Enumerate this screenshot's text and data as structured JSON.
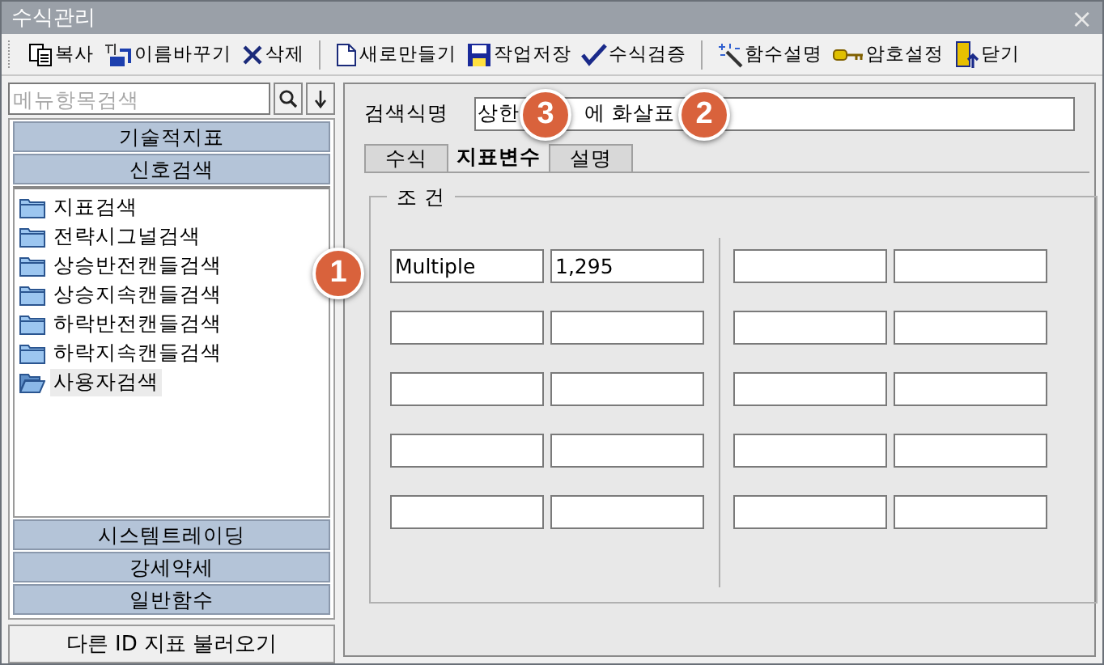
{
  "window": {
    "title": "수식관리",
    "close": "×"
  },
  "toolbar": [
    {
      "kind": "copy",
      "label": "복사"
    },
    {
      "kind": "rename",
      "label": "이름바꾸기"
    },
    {
      "kind": "delete",
      "label": "삭제"
    },
    {
      "kind": "new",
      "label": "새로만들기",
      "group_start": true
    },
    {
      "kind": "save",
      "label": "작업저장"
    },
    {
      "kind": "verify",
      "label": "수식검증"
    },
    {
      "kind": "wand",
      "label": "함수설명",
      "group_start": true
    },
    {
      "kind": "key",
      "label": "암호설정"
    },
    {
      "kind": "exit",
      "label": "닫기"
    }
  ],
  "sidebar": {
    "search": {
      "placeholder": "메뉴항목검색"
    },
    "top_sections": [
      "기술적지표",
      "신호검색"
    ],
    "items": [
      {
        "label": "지표검색",
        "selected": false
      },
      {
        "label": "전략시그널검색",
        "selected": false
      },
      {
        "label": "상승반전캔들검색",
        "selected": false
      },
      {
        "label": "상승지속캔들검색",
        "selected": false
      },
      {
        "label": "하락반전캔들검색",
        "selected": false
      },
      {
        "label": "하락지속캔들검색",
        "selected": false
      },
      {
        "label": "사용자검색",
        "selected": true
      }
    ],
    "bottom_sections": [
      "시스템트레이딩",
      "강세약세",
      "일반함수"
    ],
    "load_button": "다른 ID 지표 불러오기"
  },
  "editor": {
    "name_label": "검색식명",
    "name_value_parts": [
      "상한",
      "에 화살표"
    ],
    "tabs": [
      {
        "label": "수식",
        "selected": false
      },
      {
        "label": "지표변수",
        "selected": true
      },
      {
        "label": "설명",
        "selected": false
      }
    ],
    "group_title": "조 건",
    "left_rows": [
      [
        "Multiple",
        "1,295"
      ],
      [
        "",
        ""
      ],
      [
        "",
        ""
      ],
      [
        "",
        ""
      ],
      [
        "",
        ""
      ]
    ],
    "right_rows": [
      [
        "",
        ""
      ],
      [
        "",
        ""
      ],
      [
        "",
        ""
      ],
      [
        "",
        ""
      ],
      [
        "",
        ""
      ]
    ]
  },
  "callouts": [
    {
      "number": "1"
    },
    {
      "number": "2"
    },
    {
      "number": "3"
    }
  ]
}
